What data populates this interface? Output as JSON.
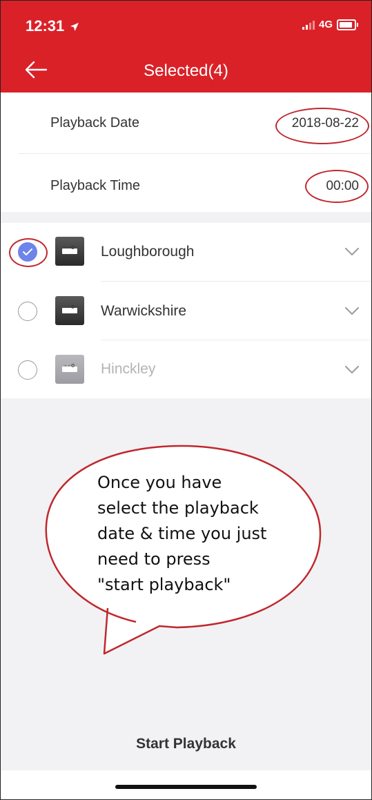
{
  "status_bar": {
    "time": "12:31",
    "network": "4G"
  },
  "nav": {
    "title": "Selected(4)"
  },
  "settings": [
    {
      "label": "Playback Date",
      "value": "2018-08-22"
    },
    {
      "label": "Playback Time",
      "value": "00:00"
    }
  ],
  "devices": [
    {
      "name": "Loughborough",
      "checked": true,
      "online": true
    },
    {
      "name": "Warwickshire",
      "checked": false,
      "online": true
    },
    {
      "name": "Hinckley",
      "checked": false,
      "online": false
    }
  ],
  "callout": {
    "lines": [
      "Once you have",
      "select the playback",
      "date & time you just",
      "need to press",
      "\"start playback\""
    ]
  },
  "footer": {
    "start_label": "Start Playback"
  },
  "colors": {
    "header": "#da2128",
    "checked": "#6f84e8",
    "annotation": "#c0272d",
    "gray_bg": "#f2f2f4"
  }
}
